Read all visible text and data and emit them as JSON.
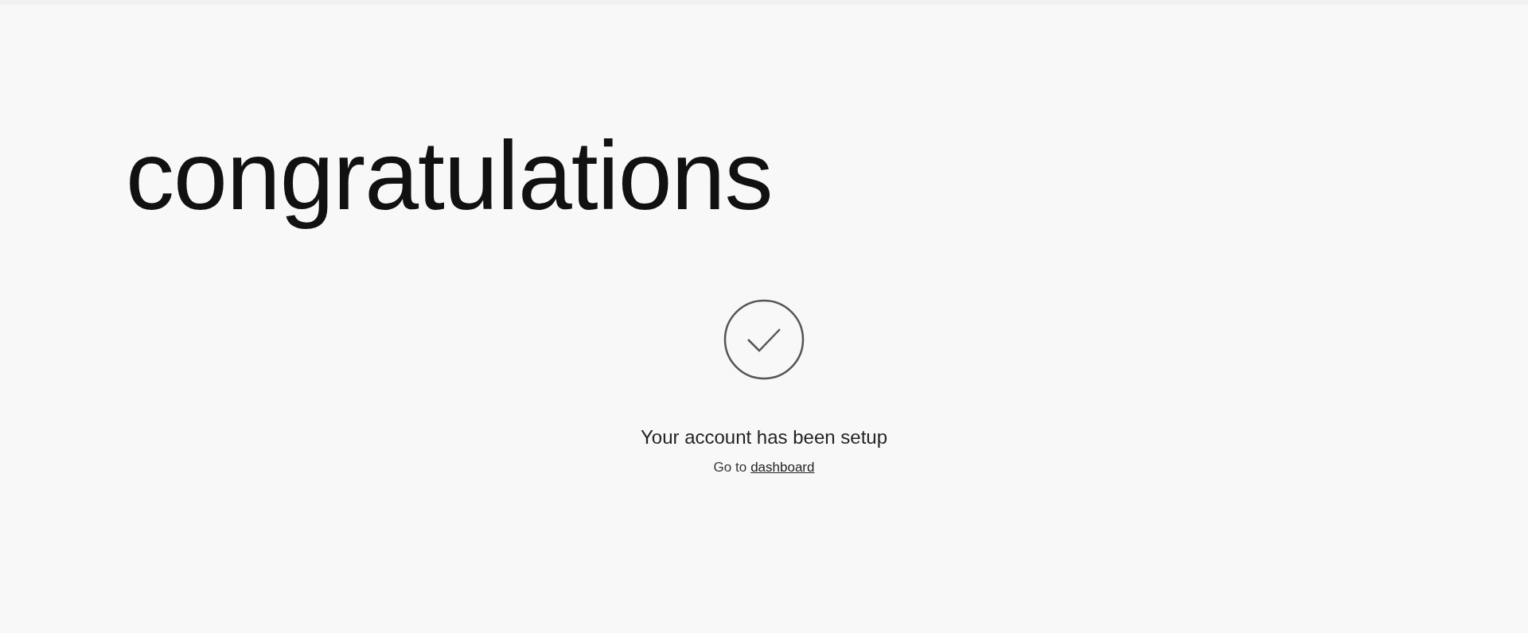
{
  "heading": "congratulations",
  "message": "Your account has been setup",
  "link_line": {
    "prefix": "Go to",
    "link": "dashboard"
  }
}
